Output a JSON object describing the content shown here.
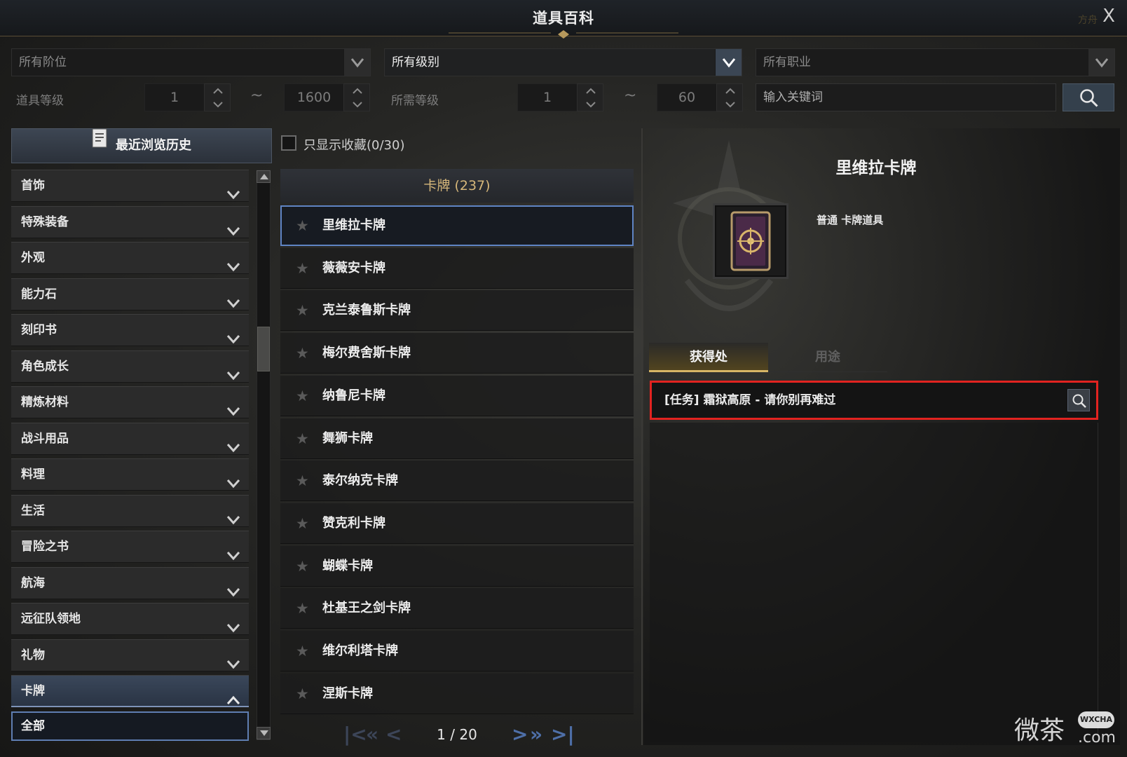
{
  "window": {
    "title": "道具百科",
    "close_label": "X",
    "corner_faint_text": "方舟"
  },
  "filters": {
    "tier_select": "所有阶位",
    "level_select": "所有级别",
    "class_select": "所有职业",
    "item_level_label": "道具等级",
    "item_level_min": "1",
    "item_level_max": "1600",
    "required_level_label": "所需等级",
    "required_level_min": "1",
    "required_level_max": "60",
    "range_sep": "~",
    "keyword_placeholder": "输入关键词"
  },
  "sidebar": {
    "history_label": "最近浏览历史",
    "categories": [
      {
        "label": "首饰"
      },
      {
        "label": "特殊装备"
      },
      {
        "label": "外观"
      },
      {
        "label": "能力石"
      },
      {
        "label": "刻印书"
      },
      {
        "label": "角色成长"
      },
      {
        "label": "精炼材料"
      },
      {
        "label": "战斗用品"
      },
      {
        "label": "料理"
      },
      {
        "label": "生活"
      },
      {
        "label": "冒险之书"
      },
      {
        "label": "航海"
      },
      {
        "label": "远征队领地"
      },
      {
        "label": "礼物"
      },
      {
        "label": "卡牌"
      }
    ],
    "open_category": "卡牌",
    "sub_item": "全部"
  },
  "list": {
    "favorites_label": "只显示收藏(0/30)",
    "header": "卡牌 (237)",
    "items": [
      {
        "name": "里维拉卡牌",
        "selected": true
      },
      {
        "name": "薇薇安卡牌"
      },
      {
        "name": "克兰泰鲁斯卡牌"
      },
      {
        "name": "梅尔费舍斯卡牌"
      },
      {
        "name": "纳鲁尼卡牌"
      },
      {
        "name": "舞狮卡牌"
      },
      {
        "name": "泰尔纳克卡牌"
      },
      {
        "name": "赞克利卡牌"
      },
      {
        "name": "蝴蝶卡牌"
      },
      {
        "name": "杜基王之剑卡牌"
      },
      {
        "name": "维尔利塔卡牌"
      },
      {
        "name": "涅斯卡牌"
      }
    ],
    "pager": {
      "current": 1,
      "total": 20,
      "text": "1 / 20"
    }
  },
  "detail": {
    "name": "里维拉卡牌",
    "type": "普通 卡牌道具",
    "tab_obtain": "获得处",
    "tab_usage": "用途",
    "source": "[任务] 霜狱高原 - 请你别再难过"
  },
  "watermark": {
    "text": "微茶",
    "badge": "WXCHA",
    "domain": ".com"
  },
  "colors": {
    "accent_blue": "#5f84c4",
    "gold": "#d7b565",
    "highlight_red": "#e22320"
  }
}
